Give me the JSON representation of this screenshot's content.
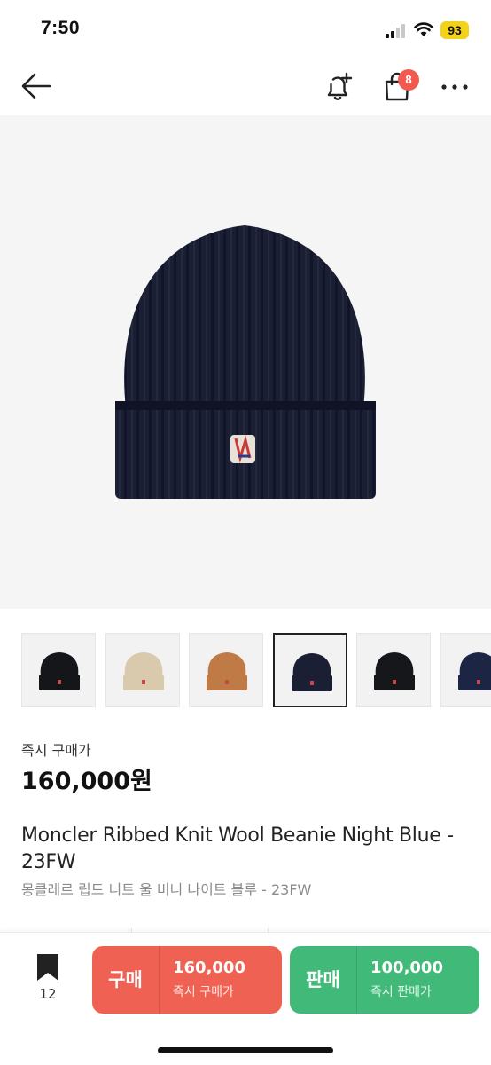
{
  "status_bar": {
    "time": "7:50",
    "battery": "93",
    "icons": [
      "signal-icon",
      "wifi-icon",
      "battery-icon"
    ]
  },
  "nav": {
    "icons": [
      "back-arrow-icon",
      "bell-plus-icon",
      "shopping-bag-icon",
      "more-icon"
    ],
    "cart_badge": "8"
  },
  "thumbnails": [
    {
      "color": "#15161a",
      "selected": false
    },
    {
      "color": "#d9c9ad",
      "selected": false
    },
    {
      "color": "#bf7a45",
      "selected": false
    },
    {
      "color": "#1b1f33",
      "selected": true
    },
    {
      "color": "#16171b",
      "selected": false
    },
    {
      "color": "#1d2544",
      "selected": false
    }
  ],
  "product": {
    "price_label": "즉시 구매가",
    "price": "160,000원",
    "title_en": "Moncler Ribbed Knit Wool Beanie Night Blue - 23FW",
    "title_ko": "몽클레르 립드 니트 울 비니 나이트 블루 - 23FW"
  },
  "bottom_bar": {
    "bookmark_count": "12",
    "buy": {
      "label": "구매",
      "price": "160,000",
      "sub": "즉시 구매가",
      "color": "#ef6253"
    },
    "sell": {
      "label": "판매",
      "price": "100,000",
      "sub": "즉시 판매가",
      "color": "#41b979"
    }
  },
  "colors": {
    "accent_red": "#ef6253",
    "accent_green": "#41b979",
    "badge": "#f25a4f",
    "battery": "#f3d21b",
    "beanie": "#1a1e33"
  }
}
